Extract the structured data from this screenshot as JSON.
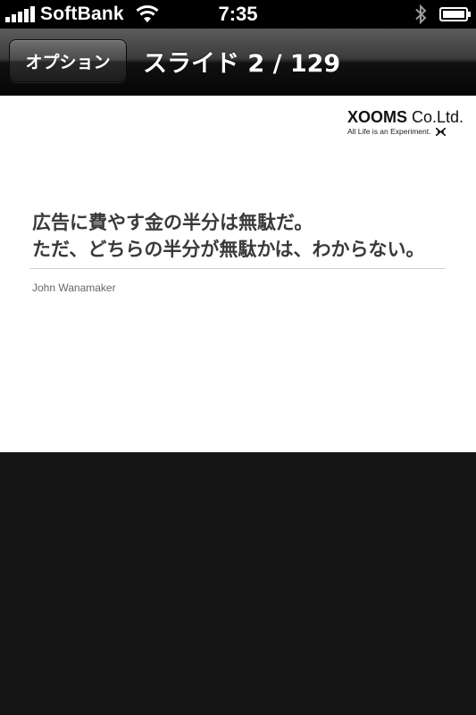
{
  "status_bar": {
    "carrier": "SoftBank",
    "time": "7:35",
    "signal_icon": "signal-bars-icon",
    "wifi_icon": "wifi-icon",
    "bluetooth_icon": "bluetooth-icon",
    "battery_icon": "battery-icon",
    "signal_bars": 5,
    "battery_level": 1.0
  },
  "nav_bar": {
    "options_label": "オプション",
    "title": "スライド 2 / 129"
  },
  "slide": {
    "logo": {
      "name_bold": "XOOMS",
      "name_rest": " Co.Ltd.",
      "tagline": "All Life is an Experiment."
    },
    "quote_lines": [
      "広告に費やす金の半分は無駄だ。",
      "ただ、どちらの半分が無駄かは、わからない。"
    ],
    "author": "John Wanamaker"
  },
  "colors": {
    "status_bar_bg": "#000000",
    "slide_bg": "#ffffff",
    "quote_text": "#3a3a3a",
    "page_bg": "#141414"
  }
}
